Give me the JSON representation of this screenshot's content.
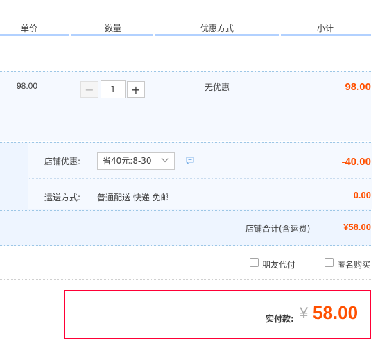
{
  "header": {
    "col_price": "单价",
    "col_qty": "数量",
    "col_promo": "优惠方式",
    "col_subtotal": "小计"
  },
  "item": {
    "price": "98.00",
    "quantity": "1",
    "minus_label": "−",
    "plus_label": "+",
    "promo": "无优惠",
    "subtotal": "98.00"
  },
  "shop": {
    "discount_label": "店铺优惠:",
    "coupon_selected": "省40元:8-30",
    "discount_amount": "-40.00",
    "shipping_label": "运送方式:",
    "shipping_method": "普通配送 快递 免邮",
    "shipping_fee": "0.00",
    "total_label": "店铺合计(含运费)",
    "total_amount": "¥58.00"
  },
  "options": {
    "friend_pay": "朋友代付",
    "anonymous": "匿名购买"
  },
  "payment": {
    "label": "实付款:",
    "currency": "¥",
    "amount": "58.00"
  },
  "colors": {
    "accent": "#ff5000",
    "header_line": "#b2d1ff",
    "row_bg": "#f5f9ff",
    "pay_border": "#ff0036"
  },
  "icons": {
    "coupon_chevron": "chevron-down-icon",
    "message": "message-icon"
  }
}
